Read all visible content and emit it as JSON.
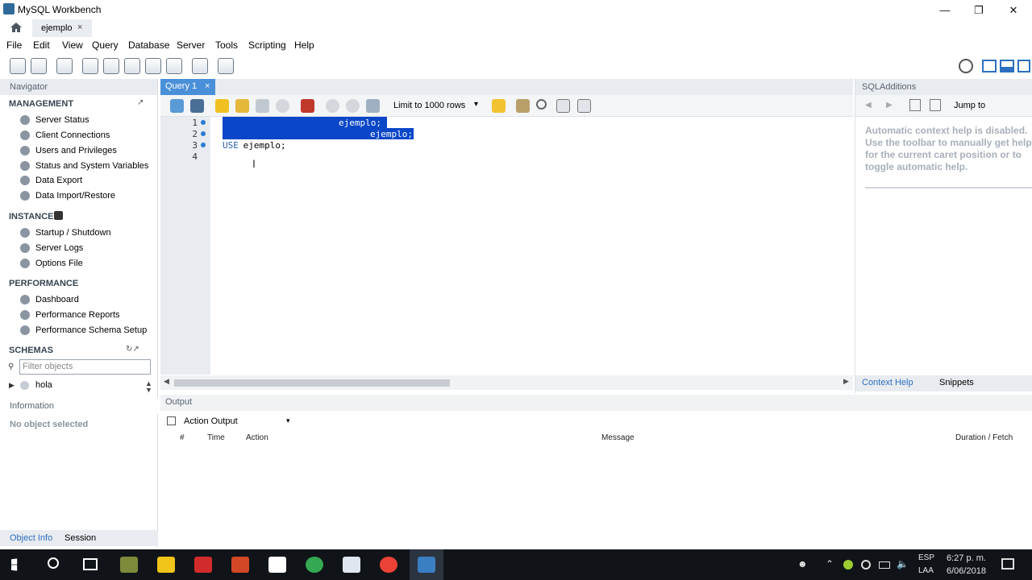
{
  "window": {
    "title": "MySQL Workbench"
  },
  "connection_tab": {
    "label": "ejemplo",
    "close": "×"
  },
  "menu": [
    "File",
    "Edit",
    "View",
    "Query",
    "Database",
    "Server",
    "Tools",
    "Scripting",
    "Help"
  ],
  "navigator": {
    "header": "Navigator",
    "management_title": "MANAGEMENT",
    "management": [
      "Server Status",
      "Client Connections",
      "Users and Privileges",
      "Status and System Variables",
      "Data Export",
      "Data Import/Restore"
    ],
    "instance_title": "INSTANCE",
    "instance": [
      "Startup / Shutdown",
      "Server Logs",
      "Options File"
    ],
    "performance_title": "PERFORMANCE",
    "performance": [
      "Dashboard",
      "Performance Reports",
      "Performance Schema Setup"
    ],
    "schemas_title": "SCHEMAS",
    "filter_placeholder": "Filter objects",
    "schema_item": "hola"
  },
  "information": {
    "header": "Information",
    "empty": "No object selected",
    "tabs": [
      "Object Info",
      "Session"
    ]
  },
  "editor": {
    "tab_label": "Query 1",
    "tab_close": "×",
    "limit_label": "Limit to 1000 rows",
    "lines": [
      {
        "num": "1",
        "text": "ejemplo;"
      },
      {
        "num": "2",
        "text": "ejemplo;"
      },
      {
        "num": "3",
        "kw": "USE",
        "text": " ejemplo;"
      },
      {
        "num": "4",
        "text": ""
      }
    ]
  },
  "additions": {
    "header": "SQLAdditions",
    "jump_to": "Jump to",
    "help_text": "Automatic context help is disabled. Use the toolbar to manually get help for the current caret position or to toggle automatic help.",
    "tabs": [
      "Context Help",
      "Snippets"
    ]
  },
  "output": {
    "header": "Output",
    "selector": "Action Output",
    "columns": [
      "#",
      "Time",
      "Action",
      "Message",
      "Duration / Fetch"
    ]
  },
  "taskbar": {
    "lang": "ESP",
    "lang2": "LAA",
    "time": "6:27 p. m.",
    "date": "6/06/2018"
  },
  "colors": {
    "accent": "#4a90d9",
    "selection": "#0a46c8",
    "taskbar": "#101418"
  }
}
